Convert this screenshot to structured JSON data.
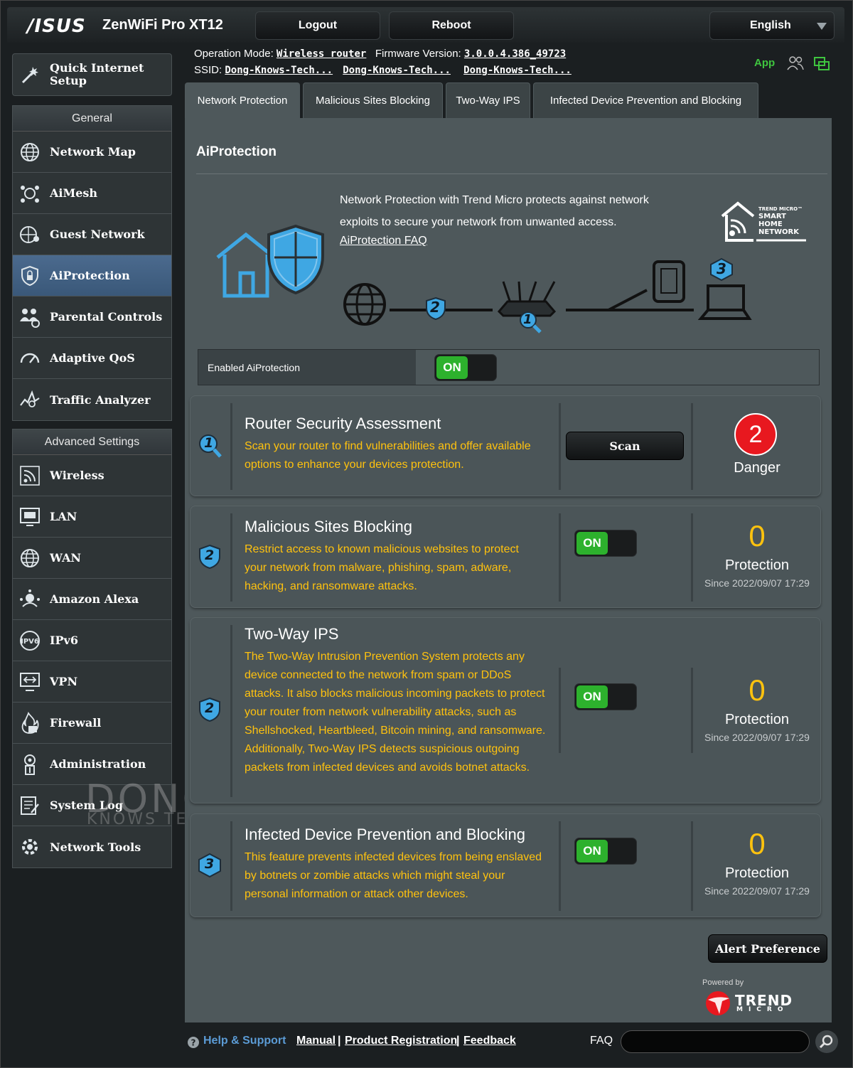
{
  "header": {
    "brand": "/ISUS",
    "model": "ZenWiFi Pro XT12",
    "logout_label": "Logout",
    "reboot_label": "Reboot",
    "language": "English"
  },
  "status": {
    "operation_mode_label": "Operation Mode:",
    "operation_mode_value": "Wireless router",
    "firmware_label": "Firmware Version:",
    "firmware_value": "3.0.0.4.386_49723",
    "ssid_label": "SSID:",
    "ssids": [
      "Dong-Knows-Tech...",
      "Dong-Knows-Tech...",
      "Dong-Knows-Tech..."
    ],
    "app_label": "App"
  },
  "sidebar": {
    "quick_setup_line1": "Quick Internet",
    "quick_setup_line2": "Setup",
    "general_header": "General",
    "general_items": [
      {
        "label": "Network Map",
        "icon": "globe-icon"
      },
      {
        "label": "AiMesh",
        "icon": "mesh-icon"
      },
      {
        "label": "Guest Network",
        "icon": "guest-globe-icon"
      },
      {
        "label": "AiProtection",
        "icon": "shield-lock-icon",
        "active": true
      },
      {
        "label": "Parental Controls",
        "icon": "family-icon"
      },
      {
        "label": "Adaptive QoS",
        "icon": "gauge-icon"
      },
      {
        "label": "Traffic Analyzer",
        "icon": "analyzer-icon"
      }
    ],
    "advanced_header": "Advanced Settings",
    "advanced_items": [
      {
        "label": "Wireless",
        "icon": "wifi-icon"
      },
      {
        "label": "LAN",
        "icon": "lan-icon"
      },
      {
        "label": "WAN",
        "icon": "wan-globe-icon"
      },
      {
        "label": "Amazon Alexa",
        "icon": "alexa-icon"
      },
      {
        "label": "IPv6",
        "icon": "ipv6-icon"
      },
      {
        "label": "VPN",
        "icon": "vpn-icon"
      },
      {
        "label": "Firewall",
        "icon": "firewall-icon"
      },
      {
        "label": "Administration",
        "icon": "admin-icon"
      },
      {
        "label": "System Log",
        "icon": "log-icon"
      },
      {
        "label": "Network Tools",
        "icon": "tools-icon"
      }
    ]
  },
  "tabs": [
    {
      "label": "Network Protection",
      "active": true
    },
    {
      "label": "Malicious Sites Blocking"
    },
    {
      "label": "Two-Way IPS"
    },
    {
      "label": "Infected Device Prevention and Blocking"
    }
  ],
  "main": {
    "title": "AiProtection",
    "description": "Network Protection with Trend Micro protects against network exploits to secure your network from unwanted access.",
    "faq_link": "AiProtection FAQ",
    "smart_home_lines": [
      "TREND MICRO™",
      "SMART",
      "HOME",
      "NETWORK"
    ],
    "diagram_badges": [
      "2",
      "1",
      "3"
    ],
    "enable_label": "Enabled AiProtection",
    "enable_state": "ON"
  },
  "cards": [
    {
      "badge": "1",
      "title": "Router Security Assessment",
      "description": "Scan your router to find vulnerabilities and offer available options to enhance your devices protection.",
      "action": "Scan",
      "count": "2",
      "status": "Danger"
    },
    {
      "badge": "2",
      "title": "Malicious Sites Blocking",
      "description": "Restrict access to known malicious websites to protect your network from malware, phishing, spam, adware, hacking, and ransomware attacks.",
      "toggle": "ON",
      "count": "0",
      "status": "Protection",
      "since": "Since 2022/09/07 17:29"
    },
    {
      "badge": "2",
      "title": "Two-Way IPS",
      "description": "The Two-Way Intrusion Prevention System protects any device connected to the network from spam or DDoS attacks. It also blocks malicious incoming packets to protect your router from network vulnerability attacks, such as Shellshocked, Heartbleed, Bitcoin mining, and ransomware. Additionally, Two-Way IPS detects suspicious outgoing packets from infected devices and avoids botnet attacks.",
      "toggle": "ON",
      "count": "0",
      "status": "Protection",
      "since": "Since 2022/09/07 17:29"
    },
    {
      "badge": "3",
      "title": "Infected Device Prevention and Blocking",
      "description": "This feature prevents infected devices from being enslaved by botnets or zombie attacks which might steal your personal information or attack other devices.",
      "toggle": "ON",
      "count": "0",
      "status": "Protection",
      "since": "Since 2022/09/07 17:29"
    }
  ],
  "alert_preference": "Alert Preference",
  "powered_by": "Powered by",
  "trend_brand": "TREND",
  "trend_sub": "MICRO",
  "footer": {
    "help": "Help & Support",
    "manual": "Manual",
    "registration": "Product Registration",
    "feedback": "Feedback",
    "faq": "FAQ",
    "sep": "|"
  },
  "watermark": {
    "line1": "DONG",
    "line2": "KNOWS TECH"
  },
  "colors": {
    "accent_yellow": "#ffc20e",
    "on_green": "#2db12d",
    "danger_red": "#e8181f",
    "active_blue": "#4b6a8e"
  }
}
